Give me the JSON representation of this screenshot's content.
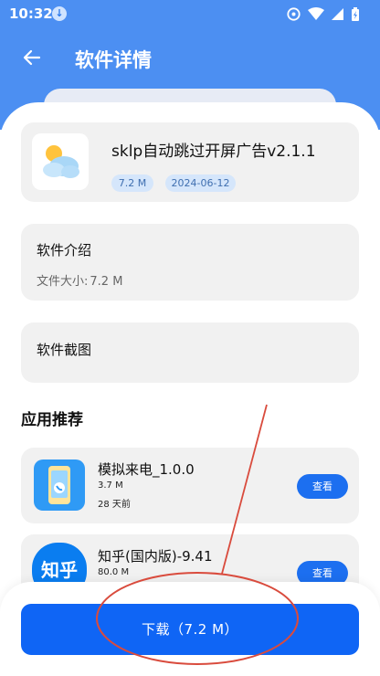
{
  "status_bar": {
    "time": "10:32"
  },
  "header": {
    "title": "软件详情",
    "back_icon": "arrow-left-icon"
  },
  "app": {
    "name": "sklp自动跳过开屏广告v2.1.1",
    "size": "7.2 M",
    "date": "2024-06-12",
    "icon": "weather-sun-cloud-icon"
  },
  "intro": {
    "title": "软件介绍",
    "size_label": "文件大小:",
    "size_value": "7.2 M"
  },
  "screenshots": {
    "title": "软件截图"
  },
  "recommend": {
    "title": "应用推荐",
    "items": [
      {
        "name": "模拟来电_1.0.0",
        "size": "3.7 M",
        "date": "28 天前",
        "button": "查看",
        "icon": "phone-call-icon"
      },
      {
        "name": "知乎(国内版)-9.41",
        "size": "80.0 M",
        "button": "查看",
        "icon": "zhihu-logo-icon",
        "icon_text": "知乎"
      }
    ]
  },
  "download": {
    "label": "下载（7.2 M）"
  },
  "colors": {
    "primary": "#4c8ff2",
    "button": "#0f65f5",
    "annotation": "#d94b3d"
  }
}
